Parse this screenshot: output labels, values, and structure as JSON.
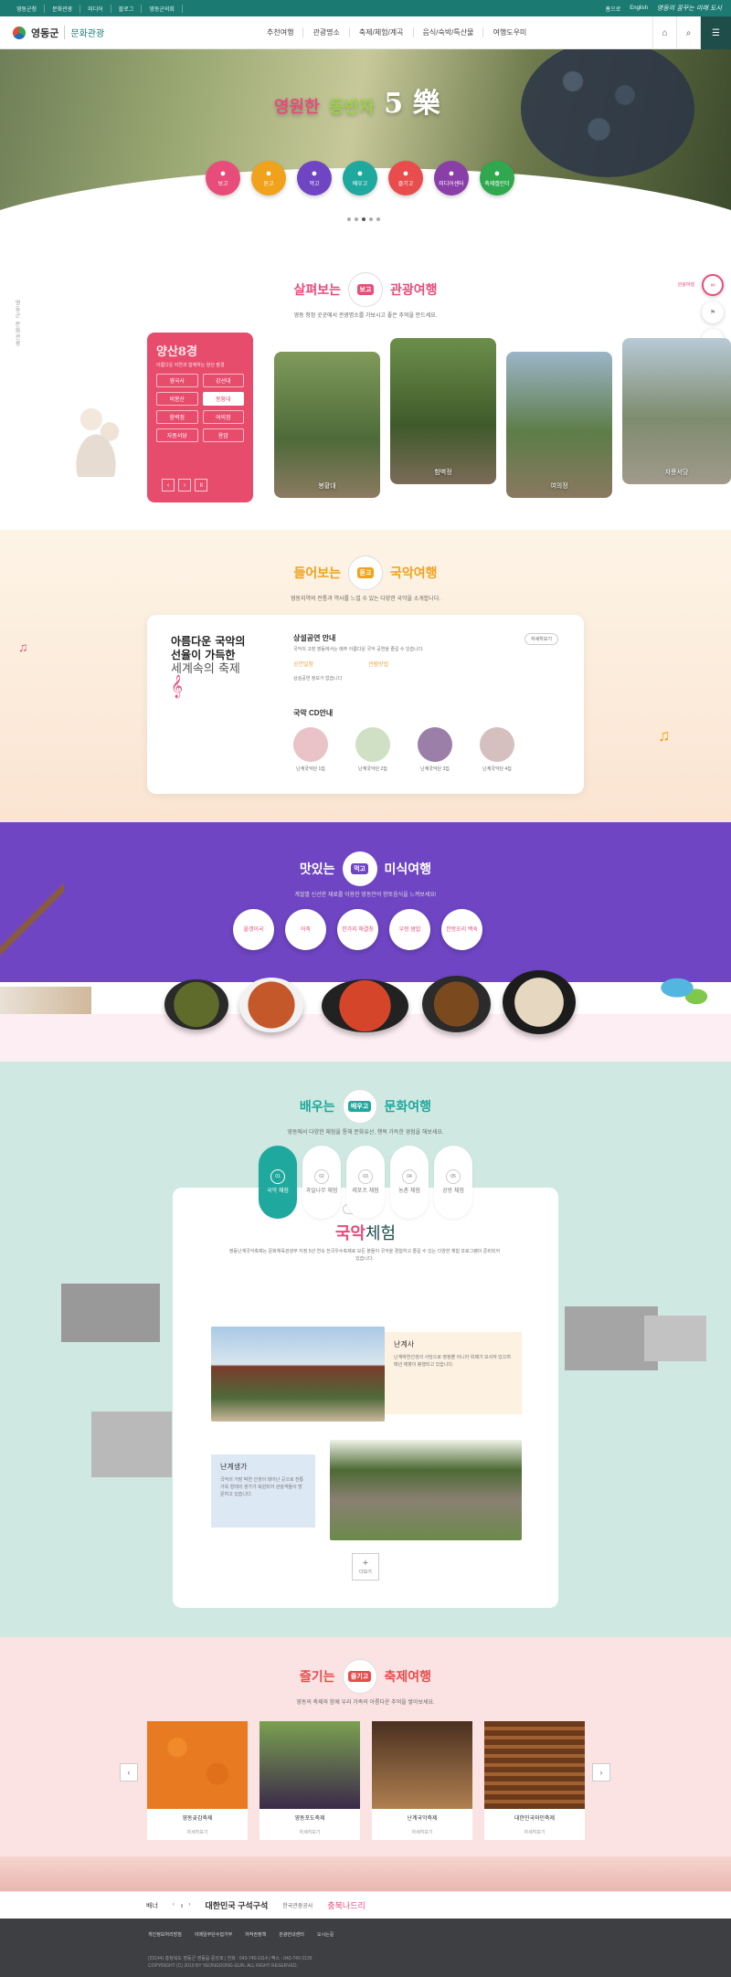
{
  "util": {
    "links": [
      "영동군청",
      "문화관광",
      "미디어",
      "블로그",
      "영동군의회"
    ],
    "right": [
      "홈으로",
      "English"
    ],
    "slogan": "영동의 꿈꾸는 미래 도시"
  },
  "header": {
    "logo_main": "영동군",
    "logo_sub": "문화관광",
    "nav": [
      "추천여행",
      "관광명소",
      "축제/체험/계곡",
      "음식/숙박/특산물",
      "여행도우미"
    ]
  },
  "hero": {
    "title_a": "영원한",
    "title_b": "동반자",
    "title_num": "5",
    "title_sym": "樂",
    "circles": [
      {
        "label": "보고",
        "color": "#e84c7a"
      },
      {
        "label": "듣고",
        "color": "#f0a21c"
      },
      {
        "label": "먹고",
        "color": "#6f45c4"
      },
      {
        "label": "배우고",
        "color": "#1fa89d"
      },
      {
        "label": "즐기고",
        "color": "#e84c4c"
      },
      {
        "label": "미디어센터",
        "color": "#8a3fa8"
      },
      {
        "label": "축제캘린더",
        "color": "#2fa84f"
      }
    ]
  },
  "s1": {
    "pre": "살펴보는",
    "badge": "보고",
    "post": "관광여행",
    "sub": "영동 청정 곳곳에서 관광명소를 가보시고 좋은 추억을 만드세요.",
    "side": "영동군 문화관광",
    "float_label": "관광여행",
    "card_title": "양산8경",
    "card_desc": "아름다운 자연과 함께하는 양산 팔경",
    "places": [
      "영국사",
      "강선대",
      "비봉산",
      "봉황대",
      "함벽정",
      "여의정",
      "자풍서당",
      "용암"
    ],
    "photos": [
      "봉황대",
      "함벽정",
      "여의정",
      "자풍서당"
    ]
  },
  "s2": {
    "pre": "들어보는",
    "badge": "듣고",
    "post": "국악여행",
    "sub": "영동지역의 전통과 역사를 느낄 수 있는 다양한 국악을 소개합니다.",
    "left1": "아름다운 국악의",
    "left2": "선율이 가득한",
    "left3": "세계속의 축제",
    "perf_h": "상설공연 안내",
    "perf_t": "국악의 고장 영동에서는 매주 아름다운 국악 공연을 즐길 수 있습니다.",
    "perf_a": "공연일정",
    "perf_b": "관람방법",
    "perf_t2": "상설공연 정보가 없습니다",
    "perf_more": "자세히보기",
    "cd_h": "국악 CD안내",
    "cds": [
      "난계국악단 1집",
      "난계국악단 2집",
      "난계국악단 3집",
      "난계국악단 4집"
    ]
  },
  "s3": {
    "pre": "맛있는",
    "badge": "먹고",
    "post": "미식여행",
    "sub": "계절별 신선한 재료를 이용한 영동만의 향토음식을 느껴보세요!",
    "items": [
      "올갱이국",
      "어죽",
      "한가지 해결칭",
      "우렁 쌈밥",
      "한방오리 백숙"
    ]
  },
  "s4": {
    "pre": "배우는",
    "badge": "배우고",
    "post": "문화여행",
    "sub": "영동에서 다양한 체험을 통해 문화유산, 행복 가득한 경험을 해보세요.",
    "tabs": [
      {
        "n": "01",
        "l": "국악 체험"
      },
      {
        "n": "02",
        "l": "과일나무 체험"
      },
      {
        "n": "03",
        "l": "레포츠 체험"
      },
      {
        "n": "04",
        "l": "농촌 체험"
      },
      {
        "n": "05",
        "l": "공방 체험"
      }
    ],
    "tag": "체험하기",
    "title_a": "국악",
    "title_b": "체험",
    "desc": "영동난계국악축제는 문화체육관광부 지정 5년 연속 전국우수축제로 모든 분들이 국악을 경험하고 즐길 수 있는 다양한 체험 프로그램이 준비되어 있습니다.",
    "box1_h": "난계사",
    "box1_t": "난계박연선생의 사당으로 영정뿐 아니라 위패가 모셔져 있으며 매년 제향이 봉행되고 있습니다.",
    "box2_h": "난계생가",
    "box2_t": "국악의 거장 박연 선생이 태어난 곳으로 전통가옥 형태의 생가가 복원되어 관광객들이 방문하고 있습니다.",
    "more": "더보기"
  },
  "s5": {
    "pre": "즐기는",
    "badge": "즐기고",
    "post": "축제여행",
    "sub": "영동의 축제와 함께 우리 가족의 아름다운 추억을 쌓아보세요.",
    "fests": [
      "영동곶감축제",
      "영동포도축제",
      "난계국악축제",
      "대한민국와인축제"
    ],
    "view": "자세히보기"
  },
  "partners": {
    "label": "배너",
    "brand1": "대한민국 구석구석",
    "brand2": "한국관광공사",
    "brand3": "충북나드리"
  },
  "footer": {
    "links": [
      "개인정보처리방침",
      "이메일무단수집거부",
      "저작권정책",
      "관광안내센터",
      "오시는길"
    ],
    "addr": "(29144) 충청북도 영동군 영동읍 중앙로 | 전화 : 043-740-3114 | 팩스 : 043-740-3139",
    "copy": "COPYRIGHT (C) 2019 BY YEONGDONG-GUN. ALL RIGHT RESERVED."
  }
}
